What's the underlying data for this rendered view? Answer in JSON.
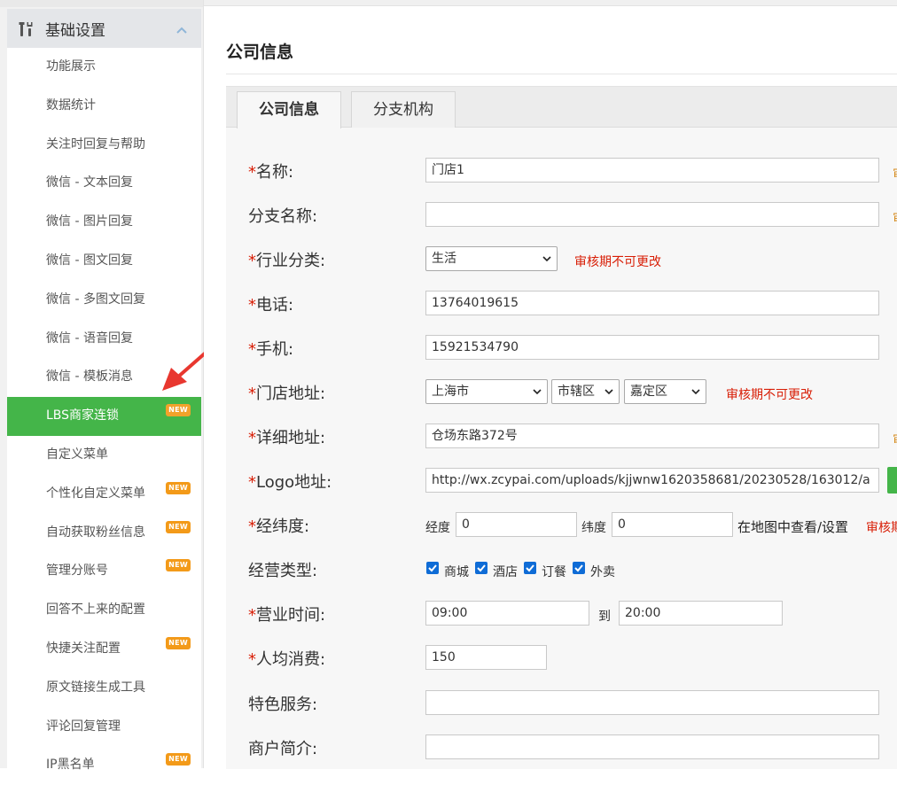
{
  "sidebar": {
    "section_title": "基础设置",
    "items": [
      {
        "label": "功能展示",
        "new": false,
        "active": false
      },
      {
        "label": "数据统计",
        "new": false,
        "active": false
      },
      {
        "label": "关注时回复与帮助",
        "new": false,
        "active": false
      },
      {
        "label": "微信 - 文本回复",
        "new": false,
        "active": false
      },
      {
        "label": "微信 - 图片回复",
        "new": false,
        "active": false
      },
      {
        "label": "微信 - 图文回复",
        "new": false,
        "active": false
      },
      {
        "label": "微信 - 多图文回复",
        "new": false,
        "active": false
      },
      {
        "label": "微信 - 语音回复",
        "new": false,
        "active": false
      },
      {
        "label": "微信 - 模板消息",
        "new": false,
        "active": false
      },
      {
        "label": "LBS商家连锁",
        "new": true,
        "active": true
      },
      {
        "label": "自定义菜单",
        "new": false,
        "active": false
      },
      {
        "label": "个性化自定义菜单",
        "new": true,
        "active": false
      },
      {
        "label": "自动获取粉丝信息",
        "new": true,
        "active": false
      },
      {
        "label": "管理分账号",
        "new": true,
        "active": false
      },
      {
        "label": "回答不上来的配置",
        "new": false,
        "active": false
      },
      {
        "label": "快捷关注配置",
        "new": true,
        "active": false
      },
      {
        "label": "原文链接生成工具",
        "new": false,
        "active": false
      },
      {
        "label": "评论回复管理",
        "new": false,
        "active": false
      },
      {
        "label": "IP黑名单",
        "new": true,
        "active": false
      }
    ],
    "new_badge": "NEW"
  },
  "page": {
    "title": "公司信息",
    "tabs": [
      {
        "label": "公司信息",
        "active": true
      },
      {
        "label": "分支机构",
        "active": false
      }
    ]
  },
  "form": {
    "required_mark": "*",
    "name": {
      "label": "名称:",
      "value": "门店1"
    },
    "branch_name": {
      "label": "分支名称:",
      "value": ""
    },
    "industry": {
      "label": "行业分类:",
      "value": "生活",
      "note": "审核期不可更改"
    },
    "phone": {
      "label": "电话:",
      "value": "13764019615"
    },
    "mobile": {
      "label": "手机:",
      "value": "15921534790"
    },
    "address": {
      "label": "门店地址:",
      "city": "上海市",
      "district_type": "市辖区",
      "district": "嘉定区",
      "note": "审核期不可更改"
    },
    "detail_address": {
      "label": "详细地址:",
      "value": "仓场东路372号"
    },
    "logo": {
      "label": "Logo地址:",
      "value": "http://wx.zcypai.com/uploads/kjjwnw1620358681/20230528/163012/a"
    },
    "coords": {
      "label": "经纬度:",
      "lng_label": "经度",
      "lng": "0",
      "lat_label": "纬度",
      "lat": "0",
      "map_link": "在地图中查看/设置",
      "note": "审核期"
    },
    "business_type": {
      "label": "经营类型:",
      "options": [
        "商城",
        "酒店",
        "订餐",
        "外卖"
      ]
    },
    "hours": {
      "label": "营业时间:",
      "start": "09:00",
      "to": "到",
      "end": "20:00"
    },
    "avg_spend": {
      "label": "人均消费:",
      "value": "150"
    },
    "feature_service": {
      "label": "特色服务:",
      "value": ""
    },
    "merchant_intro": {
      "label": "商户简介:",
      "value": ""
    }
  },
  "colors": {
    "active_green": "#44b549",
    "required_red": "#d81e06",
    "new_badge_orange": "#f39a19",
    "arrow_red": "#e8372f",
    "checkbox_blue": "#0f6cd6"
  }
}
